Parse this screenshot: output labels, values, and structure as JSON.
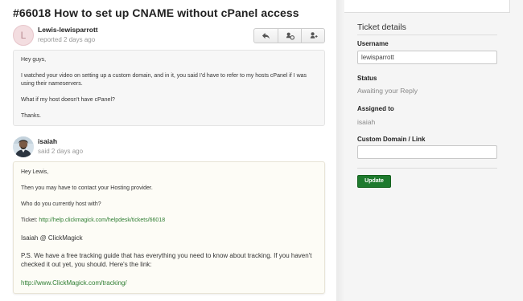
{
  "ticket": {
    "title": "#66018 How to set up CNAME without cPanel access"
  },
  "messages": [
    {
      "author": "Lewis-lewisparrott",
      "meta": "reported 2 days ago",
      "avatar_letter": "L",
      "paragraphs": [
        "Hey guys,",
        "I watched your video on setting up a custom domain, and in it, you said I'd have to refer to my hosts cPanel if I was using their nameservers.",
        "What if my host doesn't have cPanel?",
        "Thanks."
      ]
    },
    {
      "author": "isaiah",
      "meta": "said 2 days ago",
      "paragraphs": [
        "Hey Lewis,",
        "Then you may have to contact your Hosting provider.",
        "Who do you currently host with?"
      ],
      "ticket_prefix": "Ticket: ",
      "ticket_link": "http://help.clickmagick.com/helpdesk/tickets/66018",
      "signature": "Isaiah @ ClickMagick",
      "ps": "P.S. We have a free tracking guide that has everything you need to know about tracking. If you haven't checked it out yet, you should. Here's the link:",
      "tracking_link": "http://www.ClickMagick.com/tracking/"
    }
  ],
  "actions": {
    "reply_icon": "reply-icon",
    "note_icon": "note-icon",
    "forward_icon": "forward-icon"
  },
  "sidebar": {
    "title": "Ticket details",
    "username_label": "Username",
    "username_value": "lewisparrott",
    "status_label": "Status",
    "status_value": "Awaiting your Reply",
    "assigned_label": "Assigned to",
    "assigned_value": "isaiah",
    "domain_label": "Custom Domain / Link",
    "domain_value": "",
    "update_label": "Update"
  },
  "colors": {
    "link": "#2e7d32",
    "update_button": "#1e7a2e"
  }
}
